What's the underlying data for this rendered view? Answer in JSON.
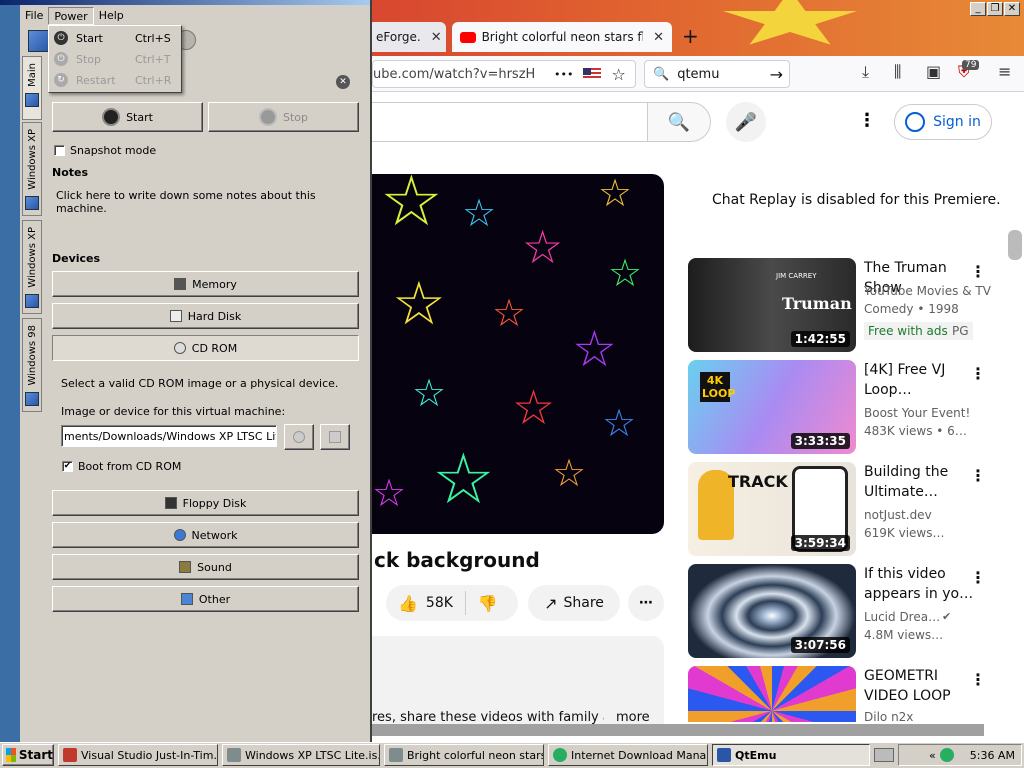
{
  "window_controls": [
    "_",
    "❐",
    "✕"
  ],
  "browser": {
    "tabs": [
      {
        "label": "eForge.",
        "active": false
      },
      {
        "label": "Bright colorful neon stars flying in",
        "active": true
      }
    ],
    "new_tab": "+",
    "url": "ube.com/watch?v=hrszH",
    "url_dots": "•••",
    "search_text": "qtemu",
    "badge_count": "79"
  },
  "youtube": {
    "sign_in": "Sign in",
    "chat_replay": "Chat Replay is disabled for this Premiere.",
    "video_title": "ck background",
    "likes": "58K",
    "share": "Share",
    "description_snippet": "res, share these videos with family an",
    "more": "more",
    "recommendations": [
      {
        "title": "The Truman Show",
        "line1": "YouTube Movies & TV",
        "line2": "Comedy • 1998",
        "badge1": "Free with ads",
        "badge2": "PG",
        "duration": "1:42:55",
        "thumb_text": "Truman",
        "thumb_sub": "JIM CARREY",
        "thumb_color": "#3a3a3a"
      },
      {
        "title": "[4K] Free VJ Loop…",
        "line1": "Boost Your Event!",
        "line2": "483K views  • 6…",
        "duration": "3:33:35",
        "thumb_text": "4K LOOP",
        "thumb_color": "#7fb6e8"
      },
      {
        "title": "Building the Ultimate…",
        "line1": "notJust.dev",
        "line2": "619K views…",
        "duration": "3:59:34",
        "thumb_text": "TRACK",
        "thumb_color": "#f4e9d8"
      },
      {
        "title": "If this video appears in yo…",
        "line1": "Lucid Drea…",
        "line2": "4.8M views…",
        "duration": "3:07:56",
        "thumb_color": "#3b4f6a"
      },
      {
        "title": "GEOMETRI VIDEO LOOP",
        "line1": "Dilo n2x",
        "line2": "",
        "duration": "",
        "thumb_color": "#9b2fc4"
      }
    ]
  },
  "qtemu": {
    "menu": [
      "File",
      "Power",
      "Help"
    ],
    "power_menu": [
      {
        "label": "Start",
        "shortcut": "Ctrl+S",
        "enabled": true
      },
      {
        "label": "Stop",
        "shortcut": "Ctrl+T",
        "enabled": false
      },
      {
        "label": "Restart",
        "shortcut": "Ctrl+R",
        "enabled": false
      }
    ],
    "vtabs": [
      "Main",
      "Windows XP",
      "Windows XP",
      "Windows 98"
    ],
    "start": "Start",
    "stop": "Stop",
    "snapshot_mode": "Snapshot mode",
    "notes_heading": "Notes",
    "notes_text": "Click here to write down some notes about this machine.",
    "devices_heading": "Devices",
    "devices": {
      "memory": "Memory",
      "hard_disk": "Hard Disk",
      "cd_rom": "CD ROM",
      "floppy": "Floppy Disk",
      "network": "Network",
      "sound": "Sound",
      "other": "Other"
    },
    "cd_hint": "Select a valid CD ROM image or a physical device.",
    "cd_image_label": "Image or device for this virtual machine:",
    "cd_path": "ments/Downloads/Windows XP LTSC Lite.iso",
    "boot_from_cd": "Boot from CD ROM",
    "boot_checked": true
  },
  "taskbar": {
    "start": "Start",
    "tasks": [
      {
        "label": "Visual Studio Just-In-Tim…",
        "active": false
      },
      {
        "label": "Windows XP LTSC Lite.is…",
        "active": false
      },
      {
        "label": "Bright colorful neon stars…",
        "active": false
      },
      {
        "label": "Internet Download Mana…",
        "active": false
      },
      {
        "label": "QtEmu",
        "active": true
      }
    ],
    "tray_chevron": "«",
    "clock": "5:36 AM"
  }
}
